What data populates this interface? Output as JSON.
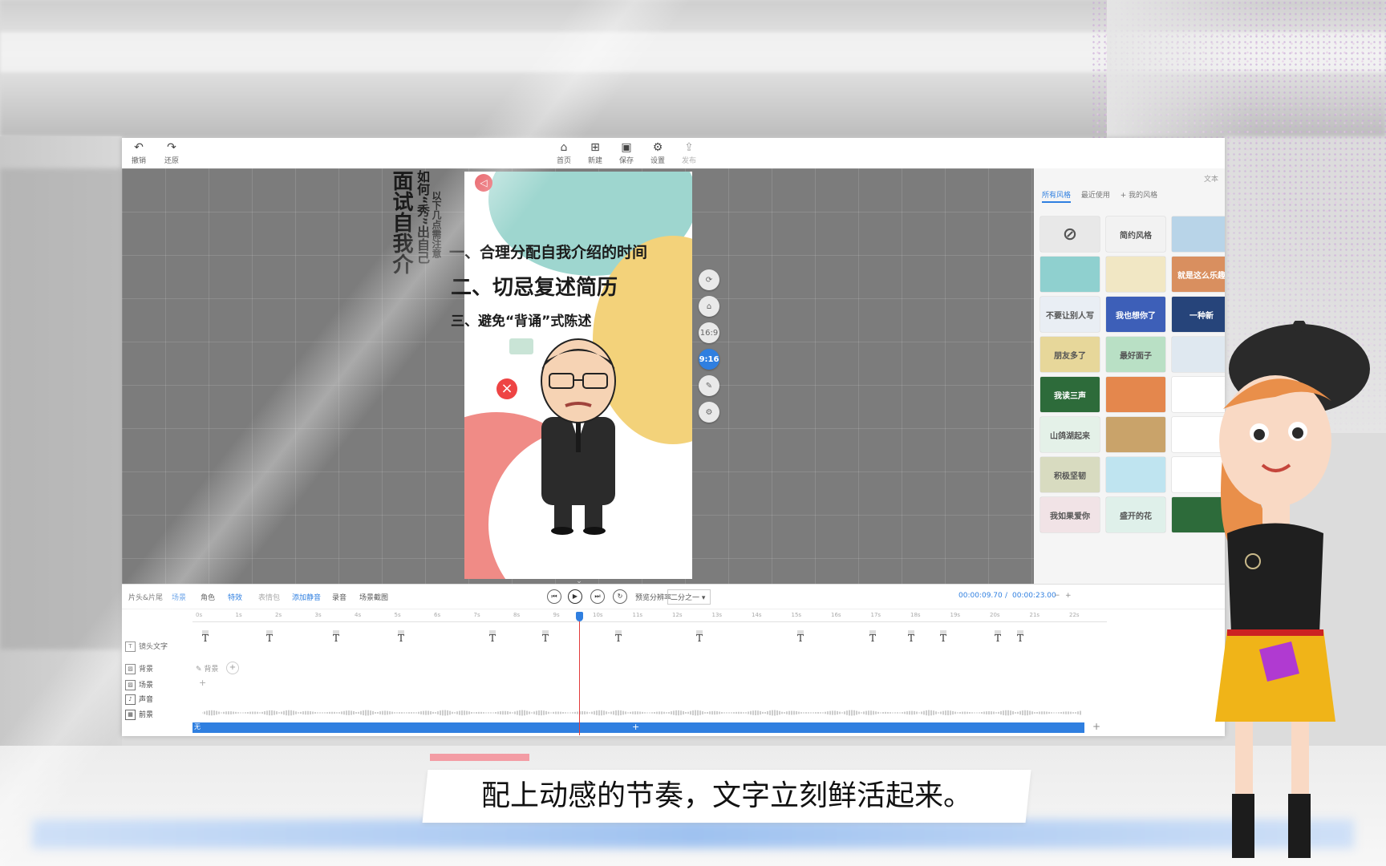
{
  "toolbar": {
    "undo": "撤销",
    "redo": "还原",
    "home": "首页",
    "new": "新建",
    "save": "保存",
    "settings": "设置",
    "publish": "发布"
  },
  "card": {
    "vertical_title": "面试自我介",
    "vertical_sub1": "如何“秀”出自己",
    "vertical_sub2": "以下几点需注意",
    "point1": "一、合理分配自我介绍的时间",
    "point2": "二、切忌复述简历",
    "point3": "三、避免“背诵”式陈述"
  },
  "side_tools": [
    "16:9",
    "9:16"
  ],
  "panel": {
    "head": "文本",
    "tabs": [
      "所有风格",
      "最近使用",
      "+ 我的风格"
    ],
    "thumbs": [
      {
        "text": "",
        "color": "#e8e8e8"
      },
      {
        "text": "简约风格",
        "color": "#f2f2f2"
      },
      {
        "text": "",
        "color": "#b8d4e8"
      },
      {
        "text": "",
        "color": "#8fd0cf"
      },
      {
        "text": "",
        "color": "#f1e7c4"
      },
      {
        "text": "就是这么乐趣",
        "color": "#d98f5f"
      },
      {
        "text": "不要让别人写",
        "color": "#e9eef4"
      },
      {
        "text": "我也想你了",
        "color": "#3d5fb8"
      },
      {
        "text": "一种新",
        "color": "#26447a"
      },
      {
        "text": "朋友多了",
        "color": "#e7d79a"
      },
      {
        "text": "最好面子",
        "color": "#b9e0c5"
      },
      {
        "text": "",
        "color": "#dfe8f0"
      },
      {
        "text": "我读三声",
        "color": "#2d6b3a"
      },
      {
        "text": "",
        "color": "#e4874d"
      },
      {
        "text": "",
        "color": "#fff"
      },
      {
        "text": "山鸽湖起来",
        "color": "#e4f1e8"
      },
      {
        "text": "",
        "color": "#c9a36a"
      },
      {
        "text": "",
        "color": "#fff"
      },
      {
        "text": "积极坚韧",
        "color": "#d8dbc0"
      },
      {
        "text": "",
        "color": "#bfe4f0"
      },
      {
        "text": "",
        "color": "#fff"
      },
      {
        "text": "我如果爱你",
        "color": "#f1e3e6"
      },
      {
        "text": "盛开的花",
        "color": "#dff0ea"
      },
      {
        "text": "",
        "color": "#2d6b3a"
      }
    ]
  },
  "timeline": {
    "tabs": [
      "片头&片尾",
      "场景",
      "角色",
      "特效",
      "表情包",
      "添加静音",
      "录音",
      "场景截图"
    ],
    "preview_label": "预览分辨率",
    "preview_value": "二分之一",
    "time_current": "00:00:09.70",
    "time_sep": "/",
    "time_total": "00:00:23.00",
    "tracks": [
      "镜头文字",
      "背景",
      "场景",
      "声音",
      "前景"
    ],
    "bg_chip": "背景",
    "ruler": [
      "0s",
      "1s",
      "2s",
      "3s",
      "4s",
      "5s",
      "6s",
      "7s",
      "8s",
      "9s",
      "10s",
      "11s",
      "12s",
      "13s",
      "14s",
      "15s",
      "16s",
      "17s",
      "18s",
      "19s",
      "20s",
      "21s",
      "22s"
    ],
    "bar_start": "无"
  },
  "subtitle": "配上动感的节奏，文字立刻鲜活起来。"
}
